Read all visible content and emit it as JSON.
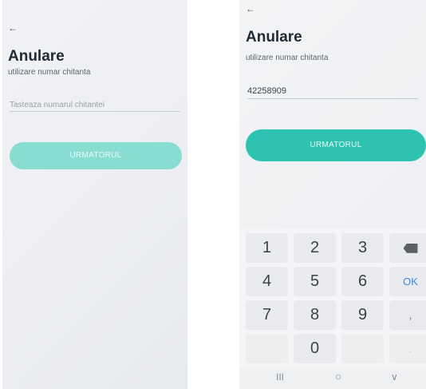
{
  "left_screen": {
    "back_glyph": "←",
    "title": "Anulare",
    "subtitle": "utilizare numar chitanta",
    "input_placeholder": "Tasteaza numarul chitantei",
    "next_button": "URMATORUL"
  },
  "right_screen": {
    "back_glyph": "←",
    "title": "Anulare",
    "subtitle": "utilizare numar chitanta",
    "input_value": "42258909",
    "next_button": "URMATORUL",
    "keypad": {
      "row1": [
        "1",
        "2",
        "3"
      ],
      "row2": [
        "4",
        "5",
        "6"
      ],
      "row3": [
        "7",
        "8",
        "9"
      ],
      "zero": "0",
      "ok": "OK",
      "comma": ",",
      "dot": ".",
      "backspace_icon": "backspace-icon"
    },
    "navbar": {
      "recents": "III",
      "home": "○",
      "back": "∨"
    }
  },
  "colors": {
    "button_disabled": "#88ddd1",
    "button_enabled": "#2ec3b1",
    "ok_key": "#3a8fe0"
  }
}
